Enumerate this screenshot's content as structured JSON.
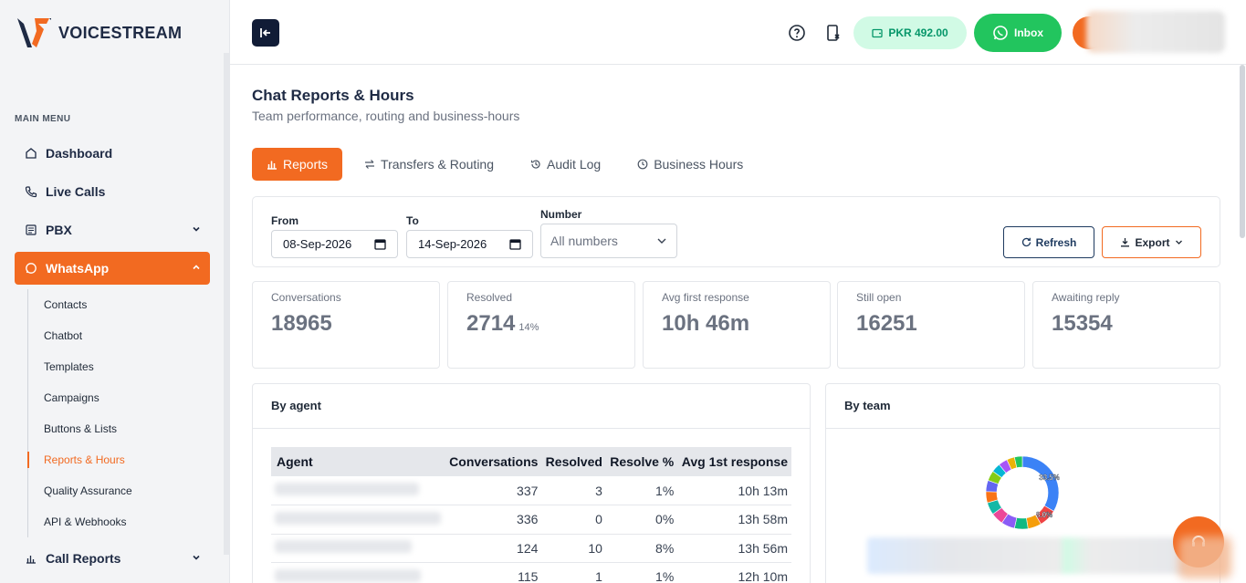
{
  "brand": {
    "name": "VOICESTREAM",
    "accent": "#f26a21",
    "navy": "#1e2a44"
  },
  "sidebar": {
    "menu_heading": "MAIN MENU",
    "items": [
      {
        "label": "Dashboard",
        "icon": "home-icon"
      },
      {
        "label": "Live Calls",
        "icon": "phone-icon"
      },
      {
        "label": "PBX",
        "icon": "pbx-icon"
      },
      {
        "label": "WhatsApp",
        "icon": "whatsapp-icon"
      },
      {
        "label": "Call Reports",
        "icon": "chart-icon"
      }
    ],
    "whatsapp_sub": [
      {
        "label": "Contacts"
      },
      {
        "label": "Chatbot"
      },
      {
        "label": "Templates"
      },
      {
        "label": "Campaigns"
      },
      {
        "label": "Buttons & Lists"
      },
      {
        "label": "Reports & Hours"
      },
      {
        "label": "Quality Assurance"
      },
      {
        "label": "API & Webhooks"
      }
    ]
  },
  "topbar": {
    "balance": "PKR 492.00",
    "inbox_label": "Inbox"
  },
  "page": {
    "title": "Chat Reports & Hours",
    "subtitle": "Team performance, routing and business-hours",
    "tabs": [
      {
        "label": "Reports",
        "icon": "bar-chart-icon"
      },
      {
        "label": "Transfers & Routing",
        "icon": "swap-icon"
      },
      {
        "label": "Audit Log",
        "icon": "history-icon"
      },
      {
        "label": "Business Hours",
        "icon": "clock-icon"
      }
    ]
  },
  "filters": {
    "from_label": "From",
    "from_value": "08-Sep-2026",
    "to_label": "To",
    "to_value": "14-Sep-2026",
    "number_label": "Number",
    "number_value": "All numbers",
    "refresh_label": "Refresh",
    "export_label": "Export"
  },
  "stats": [
    {
      "label": "Conversations",
      "value": "18965",
      "extra": ""
    },
    {
      "label": "Resolved",
      "value": "2714",
      "extra": "14%"
    },
    {
      "label": "Avg first response",
      "value": "10h 46m",
      "extra": ""
    },
    {
      "label": "Still open",
      "value": "16251",
      "extra": ""
    },
    {
      "label": "Awaiting reply",
      "value": "15354",
      "extra": ""
    }
  ],
  "by_agent": {
    "title": "By agent",
    "columns": [
      "Agent",
      "Conversations",
      "Resolved",
      "Resolve %",
      "Avg 1st response"
    ],
    "rows": [
      {
        "conversations": "337",
        "resolved": "3",
        "resolve_pct": "1%",
        "avg_first": "10h 13m"
      },
      {
        "conversations": "336",
        "resolved": "0",
        "resolve_pct": "0%",
        "avg_first": "13h 58m"
      },
      {
        "conversations": "124",
        "resolved": "10",
        "resolve_pct": "8%",
        "avg_first": "13h 56m"
      },
      {
        "conversations": "115",
        "resolved": "1",
        "resolve_pct": "1%",
        "avg_first": "12h 10m"
      }
    ]
  },
  "by_team": {
    "title": "By team",
    "chart_data": {
      "type": "pie",
      "slices": [
        {
          "value": 33.5,
          "label": "33.5%",
          "color": "#3b82f6"
        },
        {
          "value": 8.0,
          "label": "8.0%",
          "color": "#ef4444"
        },
        {
          "value": 6.0,
          "label": "",
          "color": "#f59e0b"
        },
        {
          "value": 6.0,
          "label": "",
          "color": "#10b981"
        },
        {
          "value": 6.0,
          "label": "",
          "color": "#8b5cf6"
        },
        {
          "value": 5.5,
          "label": "",
          "color": "#ec4899"
        },
        {
          "value": 5.5,
          "label": "",
          "color": "#14b8a6"
        },
        {
          "value": 5.0,
          "label": "",
          "color": "#f97316"
        },
        {
          "value": 5.0,
          "label": "",
          "color": "#6366f1"
        },
        {
          "value": 4.5,
          "label": "",
          "color": "#84cc16"
        },
        {
          "value": 4.0,
          "label": "",
          "color": "#06b6d4"
        },
        {
          "value": 4.0,
          "label": "",
          "color": "#a855f7"
        },
        {
          "value": 3.5,
          "label": "",
          "color": "#eab308"
        },
        {
          "value": 3.5,
          "label": "",
          "color": "#22c55e"
        }
      ]
    }
  }
}
